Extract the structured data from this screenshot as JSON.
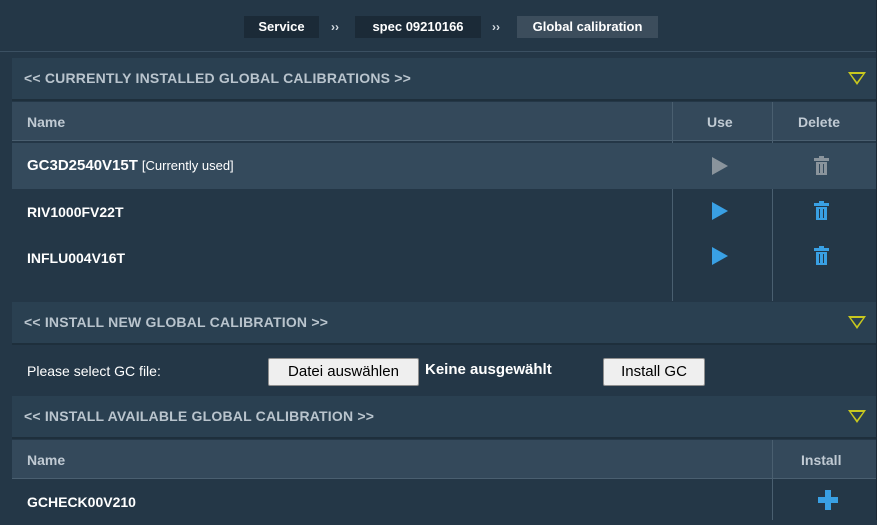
{
  "breadcrumb": {
    "items": [
      "Service",
      "spec 09210166",
      "Global calibration"
    ],
    "separator": "››"
  },
  "installed": {
    "title": "<<  CURRENTLY INSTALLED GLOBAL CALIBRATIONS  >>",
    "columns": {
      "name": "Name",
      "use": "Use",
      "delete": "Delete"
    },
    "rows": [
      {
        "name": "GC3D2540V15T",
        "tag": "[Currently used]",
        "current": true
      },
      {
        "name": "RIV1000FV22T",
        "tag": "",
        "current": false
      },
      {
        "name": "INFLU004V16T",
        "tag": "",
        "current": false
      }
    ]
  },
  "install_new": {
    "title": "<<  INSTALL NEW GLOBAL CALIBRATION  >>",
    "file_label": "Please select GC file:",
    "choose_button": "Datei auswählen",
    "no_file_text": "Keine ausgewählt",
    "install_button": "Install GC"
  },
  "available": {
    "title": "<<  INSTALL AVAILABLE GLOBAL CALIBRATION  >>",
    "columns": {
      "name": "Name",
      "install": "Install"
    },
    "rows": [
      {
        "name": "GCHECK00V210"
      }
    ]
  },
  "colors": {
    "background": "#243747",
    "accent": "#39a0e4",
    "toggle": "#c8c81e",
    "disabled": "#8a949c"
  },
  "icons": [
    "play-icon",
    "trash-icon",
    "plus-icon",
    "collapse-triangle-icon"
  ]
}
